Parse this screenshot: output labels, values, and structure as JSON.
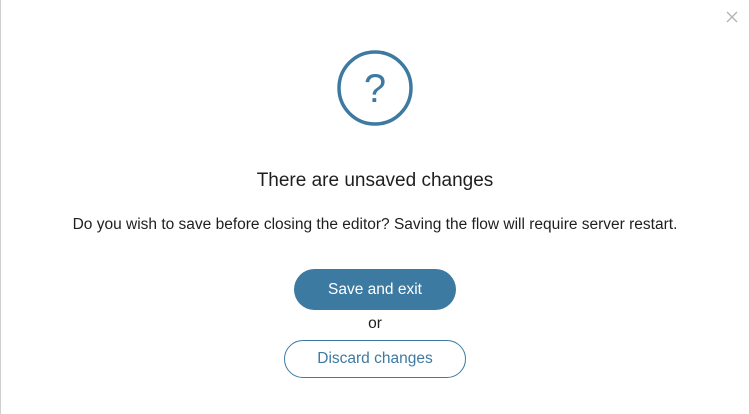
{
  "dialog": {
    "title": "There are unsaved changes",
    "message": "Do you wish to save before closing the editor? Saving the flow will require server restart.",
    "icon": "question-circle-icon",
    "close_icon": "close-icon",
    "save_label": "Save and exit",
    "separator": "or",
    "discard_label": "Discard changes"
  },
  "colors": {
    "accent": "#3d7aa1",
    "text": "#1f1f1f",
    "close": "#b5b5b5"
  }
}
